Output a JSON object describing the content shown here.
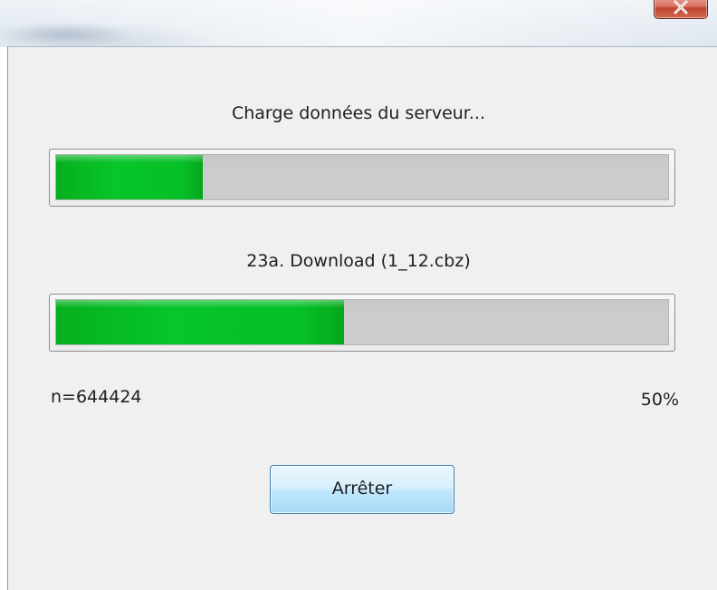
{
  "window": {
    "close_icon": "close-icon"
  },
  "dialog": {
    "status_text": "Charge données du serveur...",
    "overall_progress": 0.24,
    "file_text": "23a. Download (1_12.cbz)",
    "file_progress": 0.47,
    "count_text": "n=644424",
    "percent_text": "50%",
    "stop_label": "Arrêter"
  },
  "colors": {
    "progress_fill": "#07c52a",
    "progress_track": "#cbcbcb",
    "button_border": "#3c7fb1",
    "close_button": "#c1442d"
  }
}
